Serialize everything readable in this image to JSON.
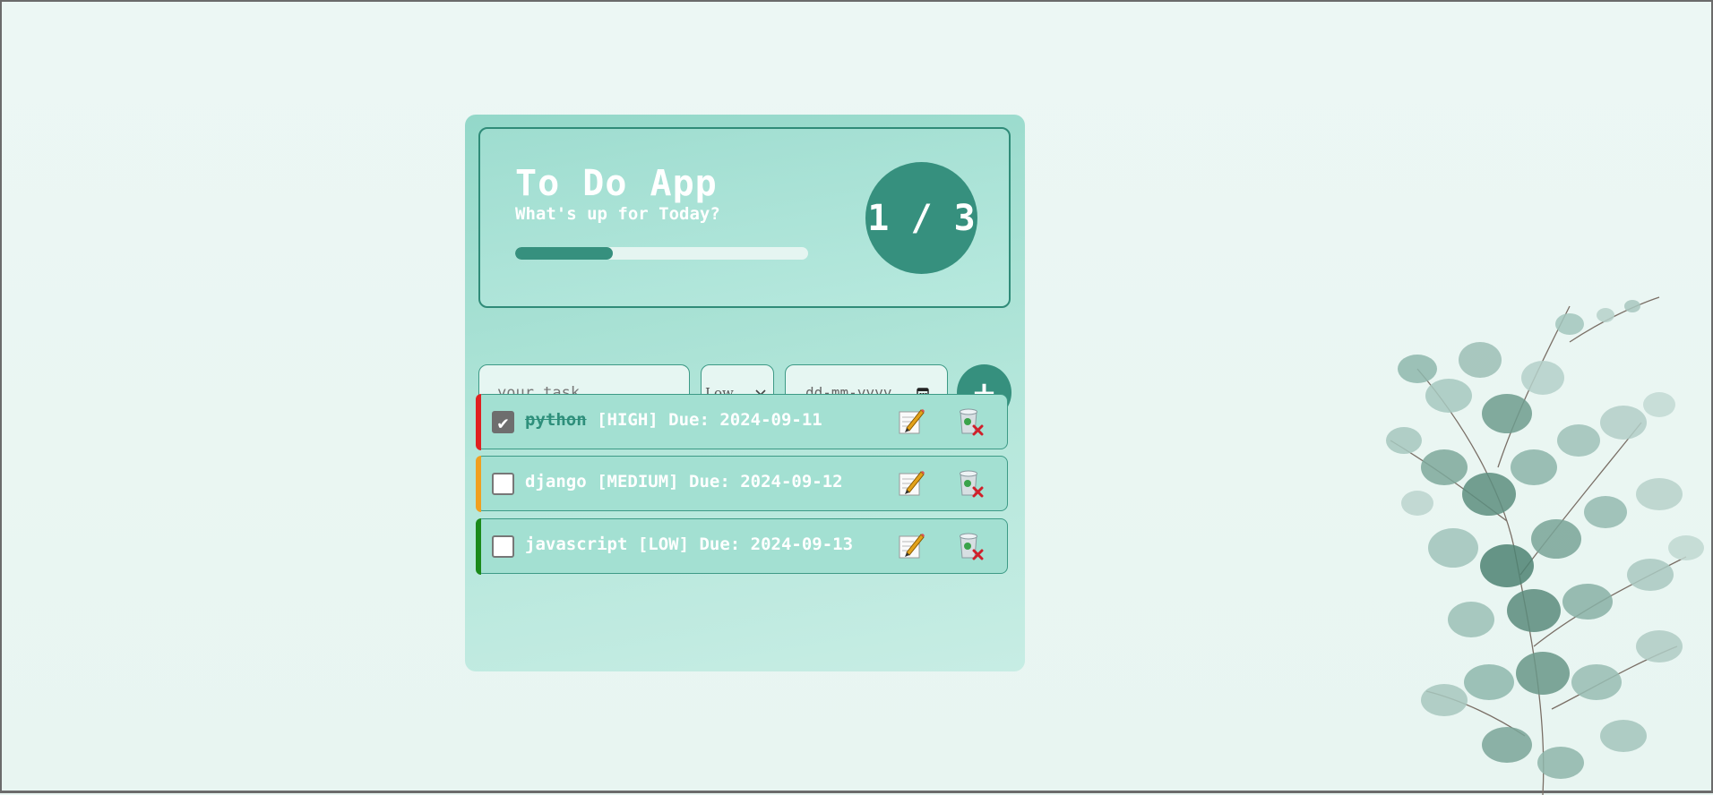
{
  "app": {
    "title": "To Do App",
    "subtitle": "What's up for Today?",
    "counter": "1 / 3",
    "progress": 0.333,
    "accent_color": "#36907e"
  },
  "form": {
    "task_placeholder": "your task....",
    "priority_value": "Low",
    "date_placeholder": "dd-mm-yyyy",
    "add_label": "+"
  },
  "tasks": [
    {
      "name": "python",
      "meta": "[HIGH] Due: 2024-09-11",
      "done": true,
      "priority_color": "#e02020"
    },
    {
      "name": "django",
      "meta": "[MEDIUM] Due: 2024-09-12",
      "done": false,
      "priority_color": "#f0a020"
    },
    {
      "name": "javascript",
      "meta": "[LOW] Due: 2024-09-13",
      "done": false,
      "priority_color": "#1a8a1a"
    }
  ],
  "icons": {
    "edit": "pencil-paper-icon",
    "delete": "recycle-bin-delete-icon",
    "calendar": "calendar-icon",
    "decoration": "eucalyptus-plant"
  }
}
